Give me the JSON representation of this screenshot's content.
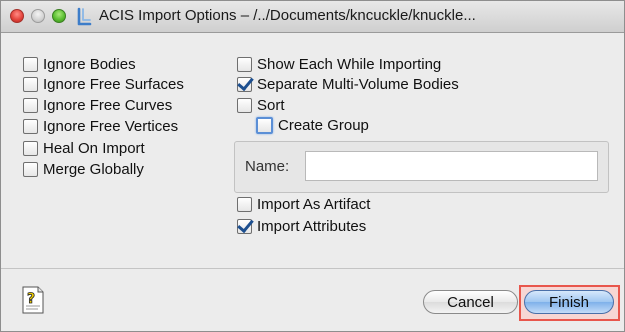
{
  "window": {
    "title": "ACIS Import Options – /../Documents/kncuckle/knuckle..."
  },
  "left_options": [
    {
      "label": "Ignore Bodies",
      "checked": false
    },
    {
      "label": "Ignore Free Surfaces",
      "checked": false
    },
    {
      "label": "Ignore Free Curves",
      "checked": false
    },
    {
      "label": "Ignore Free Vertices",
      "checked": false
    },
    {
      "label": "Heal On Import",
      "checked": false
    },
    {
      "label": "Merge Globally",
      "checked": false
    }
  ],
  "right_options": [
    {
      "label": "Show Each While Importing",
      "checked": false
    },
    {
      "label": "Separate Multi-Volume Bodies",
      "checked": true
    },
    {
      "label": "Sort",
      "checked": false
    }
  ],
  "create_group": {
    "label": "Create Group",
    "checked": false
  },
  "name_field": {
    "label": "Name:",
    "value": "",
    "placeholder": ""
  },
  "bottom_options": [
    {
      "label": "Import As Artifact",
      "checked": false
    },
    {
      "label": "Import Attributes",
      "checked": true
    }
  ],
  "buttons": {
    "cancel": "Cancel",
    "finish": "Finish"
  },
  "colors": {
    "accent": "#7fb1ea",
    "highlight": "#e8564c",
    "checkmark": "#1d4f8f"
  }
}
